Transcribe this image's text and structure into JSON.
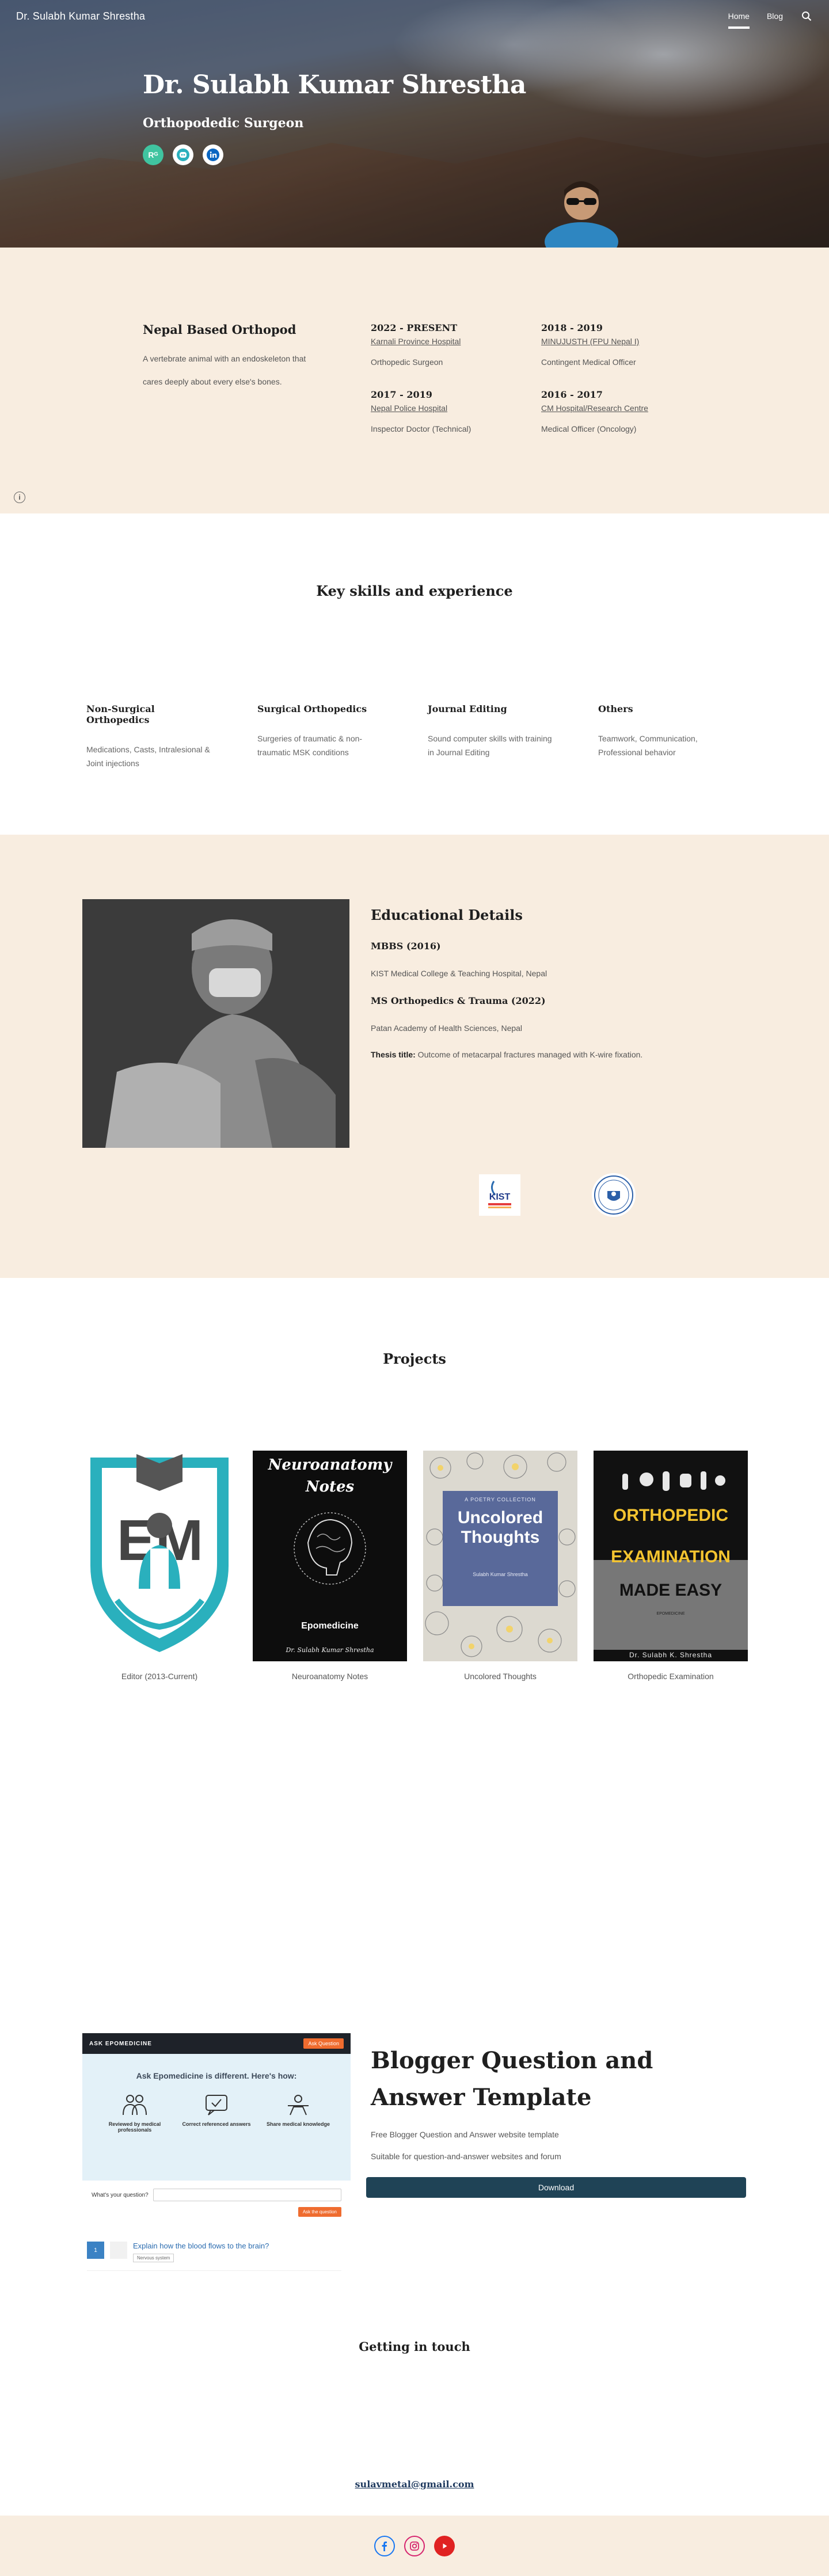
{
  "header": {
    "site_title": "Dr. Sulabh Kumar Shrestha",
    "nav": [
      {
        "label": "Home",
        "active": true
      },
      {
        "label": "Blog",
        "active": false
      }
    ]
  },
  "hero": {
    "name": "Dr. Sulabh Kumar Shrestha",
    "role": "Orthopodedic Surgeon",
    "icons": [
      "researchgate-icon",
      "discord-icon",
      "linkedin-icon"
    ],
    "rg_text": "Rᴳ"
  },
  "about": {
    "title": "Nepal Based Orthopod",
    "text": "A vertebrate animal with an endoskeleton that cares deeply about every else's bones."
  },
  "jobs": [
    {
      "period": "2022 - PRESENT",
      "place": "Karnali Province Hospital",
      "role": "Orthopedic Surgeon"
    },
    {
      "period": "2018 - 2019",
      "place": "MINUJUSTH (FPU Nepal I)",
      "role": "Contingent Medical Officer"
    },
    {
      "period": "2017 - 2019",
      "place": "Nepal Police Hospital",
      "role": "Inspector Doctor (Technical)"
    },
    {
      "period": "2016 - 2017",
      "place": "CM Hospital/Research Centre",
      "role": "Medical Officer (Oncology)"
    }
  ],
  "skills": {
    "title": "Key skills and experience",
    "items": [
      {
        "title": "Non-Surgical Orthopedics",
        "desc": "Medications, Casts, Intralesional & Joint injections"
      },
      {
        "title": "Surgical Orthopedics",
        "desc": "Surgeries of traumatic & non-traumatic MSK conditions"
      },
      {
        "title": "Journal Editing",
        "desc": "Sound computer skills with training in Journal Editing"
      },
      {
        "title": "Others",
        "desc": "Teamwork, Communication, Professional behavior"
      }
    ]
  },
  "education": {
    "title": "Educational Details",
    "mbbs": "MBBS (2016)",
    "mbbs_inst": "KIST Medical College & Teaching Hospital, Nepal",
    "ms": "MS Orthopedics & Trauma (2022)",
    "ms_inst": "Patan Academy of Health Sciences, Nepal",
    "thesis_label": "Thesis title:",
    "thesis_text": " Outcome of metacarpal fractures managed with K-wire fixation.",
    "kist_logo_text": "KIST"
  },
  "projects": {
    "title": "Projects",
    "items": [
      {
        "caption": "Editor (2013-Current)",
        "logo_text": "EM"
      },
      {
        "caption": "Neuroanatomy Notes",
        "cover_title": "Neuroanatomy Notes",
        "cover_sub": "Epomedicine",
        "cover_author": "Dr. Sulabh Kumar Shrestha"
      },
      {
        "caption": "Uncolored Thoughts",
        "cover_kicker": "A POETRY COLLECTION",
        "cover_title": "Uncolored Thoughts",
        "cover_author": "Sulabh Kumar Shrestha"
      },
      {
        "caption": "Orthopedic Examination",
        "cover_title1": "ORTHOPEDIC",
        "cover_title2": "EXAMINATION",
        "cover_title3": "MADE EASY",
        "cover_sub": "EPOMEDICINE",
        "cover_author": "Dr. Sulabh K. Shrestha"
      }
    ]
  },
  "qa": {
    "mock_brand": "ASK EPOMEDICINE",
    "mock_btn": "Ask Question",
    "mock_heading": "Ask Epomedicine is different. Here's how:",
    "mock_features": [
      "Reviewed by medical professionals",
      "Correct referenced answers",
      "Share medical knowledge"
    ],
    "mock_question_label": "What's your question?",
    "mock_submit": "Ask the question",
    "mock_item": "Explain how the blood flows to the brain?",
    "mock_tag": "Nervous system",
    "mock_count": "1",
    "title": "Blogger Question and Answer Template",
    "line1": "Free Blogger Question and Answer website template",
    "line2": "Suitable for question-and-answer websites and forum",
    "download": "Download"
  },
  "contact": {
    "title": "Getting in touch",
    "email": "sulavmetal@gmail.com",
    "social": [
      "facebook-icon",
      "instagram-icon",
      "youtube-icon"
    ]
  },
  "colors": {
    "beige": "#f8ede0",
    "accent_dark": "#1f4356",
    "teal": "#2ab0bd",
    "orange": "#ef6c2f"
  }
}
